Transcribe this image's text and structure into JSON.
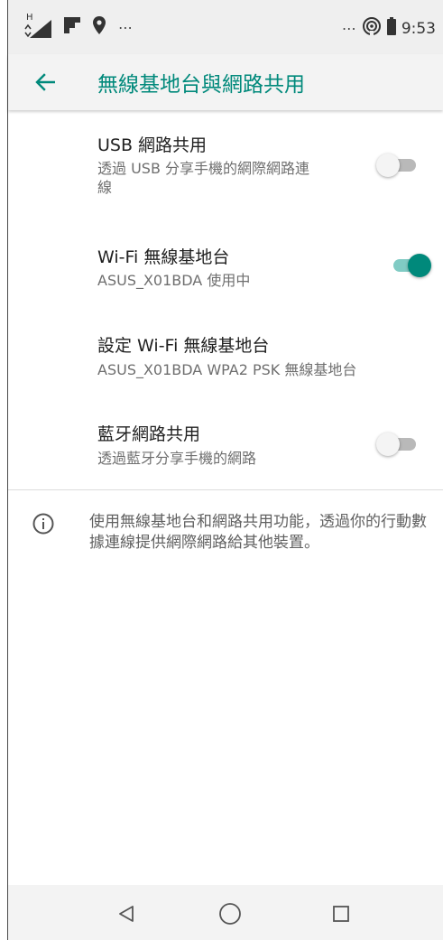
{
  "status_bar": {
    "time": "9:53",
    "left_icons": [
      "signal-icon",
      "flipboard-icon",
      "location-icon",
      "more-icon"
    ],
    "right_icons": [
      "more-icon",
      "hotspot-icon",
      "battery-icon"
    ],
    "signal_label": "H"
  },
  "toolbar": {
    "title": "無線基地台與網路共用"
  },
  "settings": [
    {
      "title": "USB 網路共用",
      "subtitle": "透過 USB 分享手機的網際網路連\n線",
      "toggle": false,
      "has_toggle": true
    },
    {
      "title": "Wi-Fi 無線基地台",
      "subtitle": "ASUS_X01BDA 使用中",
      "toggle": true,
      "has_toggle": true
    },
    {
      "title": "設定 Wi-Fi 無線基地台",
      "subtitle": "ASUS_X01BDA WPA2 PSK 無線基地台",
      "has_toggle": false
    },
    {
      "title": "藍牙網路共用",
      "subtitle": "透過藍牙分享手機的網路",
      "toggle": false,
      "has_toggle": true
    }
  ],
  "info": {
    "text": "使用無線基地台和網路共用功能，透過你的行動數據連線提供網際網路給其他裝置。"
  },
  "colors": {
    "accent": "#00897b",
    "accent_track": "#80cbc4"
  }
}
